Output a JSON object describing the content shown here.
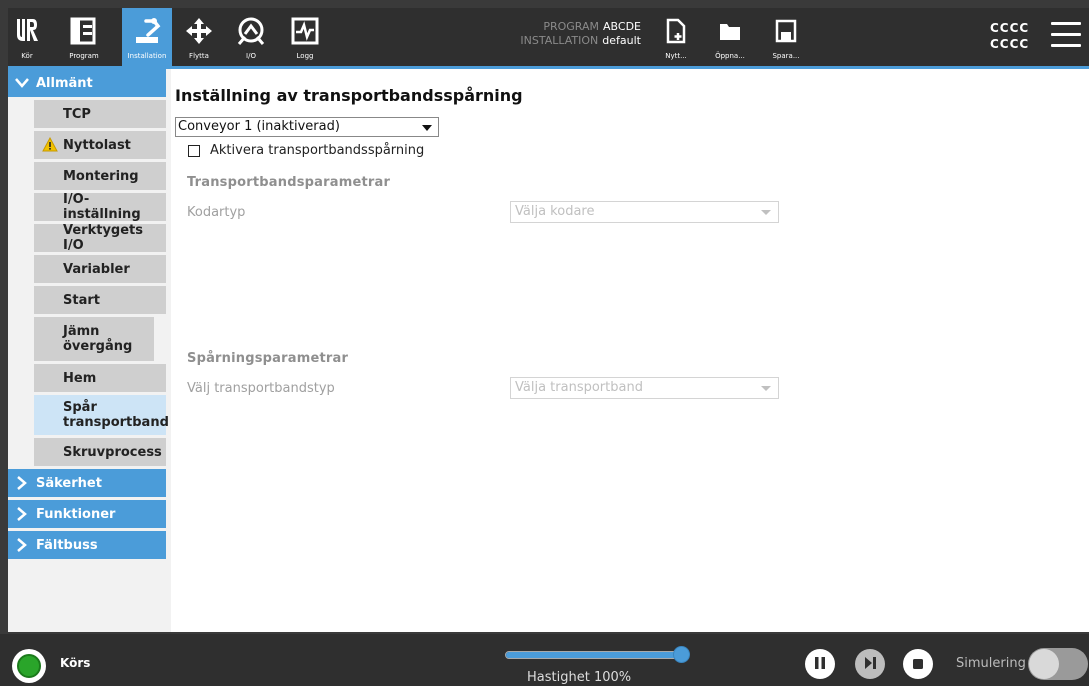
{
  "topbar": {
    "buttons": [
      {
        "label": "Kör",
        "icon": "ur-logo-icon"
      },
      {
        "label": "Program",
        "icon": "program-tree-icon"
      },
      {
        "label": "Installation",
        "icon": "installation-robot-icon"
      },
      {
        "label": "Flytta",
        "icon": "move-arrows-icon"
      },
      {
        "label": "I/O",
        "icon": "io-gauge-icon"
      },
      {
        "label": "Logg",
        "icon": "log-chart-icon"
      }
    ],
    "program_label": "PROGRAM",
    "program_value": "ABCDE",
    "installation_label": "INSTALLATION",
    "installation_value": "default",
    "file_buttons": [
      {
        "label": "Nytt...",
        "icon": "new-file-icon"
      },
      {
        "label": "Öppna...",
        "icon": "folder-icon"
      },
      {
        "label": "Spara...",
        "icon": "save-disk-icon"
      }
    ],
    "user_line1": "CCCC",
    "user_line2": "CCCC"
  },
  "sidebar": {
    "categories": [
      {
        "label": "Allmänt",
        "expanded": true
      },
      {
        "label": "Säkerhet",
        "expanded": false
      },
      {
        "label": "Funktioner",
        "expanded": false
      },
      {
        "label": "Fältbuss",
        "expanded": false
      }
    ],
    "items": [
      {
        "label": "TCP"
      },
      {
        "label": "Nyttolast",
        "warning": true
      },
      {
        "label": "Montering"
      },
      {
        "label": "I/O-inställning"
      },
      {
        "label": "Verktygets I/O"
      },
      {
        "label": "Variabler"
      },
      {
        "label": "Start"
      },
      {
        "label": "Jämn övergång"
      },
      {
        "label": "Hem"
      },
      {
        "label": "Spår transportband",
        "selected": true
      },
      {
        "label": "Skruvprocess"
      }
    ]
  },
  "main": {
    "title": "Inställning av transportbandsspårning",
    "conveyor_select_value": "Conveyor 1 (inaktiverad)",
    "enable_label": "Aktivera transportbandsspårning",
    "enable_checked": false,
    "section1_heading": "Transportbandsparametrar",
    "encoder_label": "Kodartyp",
    "encoder_placeholder": "Välja kodare",
    "section2_heading": "Spårningsparametrar",
    "conveyor_type_label": "Välj transportbandstyp",
    "conveyor_type_placeholder": "Välja transportband"
  },
  "bottombar": {
    "status": "Körs",
    "speed_label": "Hastighet 100%",
    "speed_fraction": 1.0,
    "simulation_label": "Simulering",
    "simulation_on": false,
    "controls": [
      "pause-icon",
      "step-icon",
      "stop-icon"
    ]
  },
  "colors": {
    "accent": "#4b9cd9",
    "bar_bg": "#2f2f2f",
    "status_green": "#2aa52a",
    "warning": "#f2c200"
  }
}
